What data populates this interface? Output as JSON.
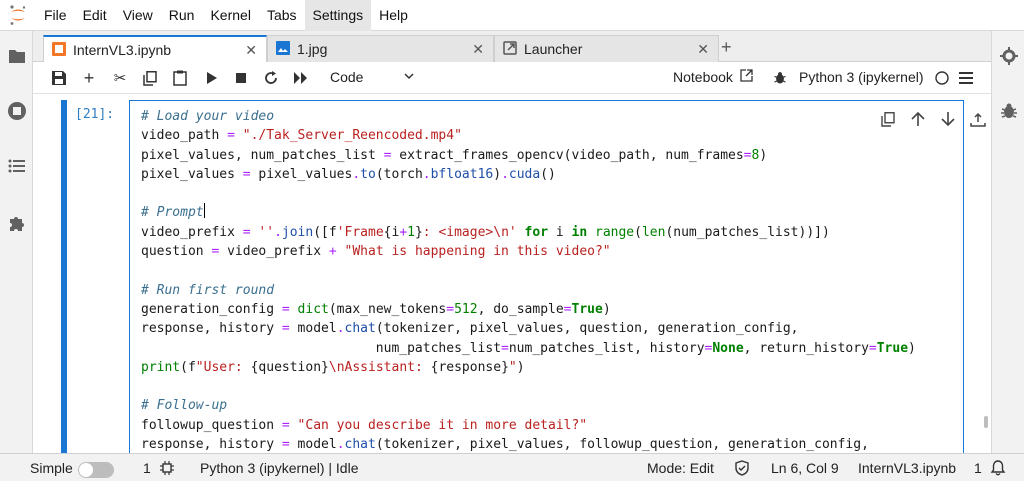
{
  "menu": {
    "items": [
      "File",
      "Edit",
      "View",
      "Run",
      "Kernel",
      "Tabs",
      "Settings",
      "Help"
    ],
    "active": "Settings"
  },
  "tabs": [
    {
      "label": "InternVL3.ipynb",
      "icon": "notebook-icon",
      "active": true
    },
    {
      "label": "1.jpg",
      "icon": "image-icon",
      "active": false
    },
    {
      "label": "Launcher",
      "icon": "launcher-icon",
      "active": false
    }
  ],
  "toolbar": {
    "cell_type": "Code",
    "notebook_label": "Notebook",
    "kernel_label": "Python 3 (ipykernel)"
  },
  "cell": {
    "prompt": "[21]:",
    "lines": [
      [
        [
          "c",
          "# Load your video"
        ]
      ],
      [
        [
          "",
          "video_path "
        ],
        [
          "o",
          "="
        ],
        [
          "",
          " "
        ],
        [
          "s",
          "\"./Tak_Server_Reencoded.mp4\""
        ]
      ],
      [
        [
          "",
          "pixel_values, num_patches_list "
        ],
        [
          "o",
          "="
        ],
        [
          "",
          " extract_frames_opencv(video_path, num_frames"
        ],
        [
          "o",
          "="
        ],
        [
          "n",
          "8"
        ],
        [
          "",
          ")"
        ]
      ],
      [
        [
          "",
          "pixel_values "
        ],
        [
          "o",
          "="
        ],
        [
          "",
          " pixel_values"
        ],
        [
          "o",
          "."
        ],
        [
          "f",
          "to"
        ],
        [
          "",
          "(torch"
        ],
        [
          "o",
          "."
        ],
        [
          "f",
          "bfloat16"
        ],
        [
          "",
          ")"
        ],
        [
          "o",
          "."
        ],
        [
          "f",
          "cuda"
        ],
        [
          "",
          "()"
        ]
      ],
      [],
      [
        [
          "c",
          "# Prompt"
        ],
        [
          "cursor",
          ""
        ]
      ],
      [
        [
          "",
          "video_prefix "
        ],
        [
          "o",
          "="
        ],
        [
          "",
          " "
        ],
        [
          "s",
          "''"
        ],
        [
          "o",
          "."
        ],
        [
          "f",
          "join"
        ],
        [
          "",
          "([f"
        ],
        [
          "s",
          "'Frame"
        ],
        [
          "",
          "{i"
        ],
        [
          "o",
          "+"
        ],
        [
          "n",
          "1"
        ],
        [
          "",
          "}"
        ],
        [
          "s",
          ": <image>\\n'"
        ],
        [
          "",
          " "
        ],
        [
          "k",
          "for"
        ],
        [
          "",
          " i "
        ],
        [
          "k",
          "in"
        ],
        [
          "",
          " "
        ],
        [
          "b",
          "range"
        ],
        [
          "",
          "("
        ],
        [
          "b",
          "len"
        ],
        [
          "",
          "(num_patches_list))])"
        ]
      ],
      [
        [
          "",
          "question "
        ],
        [
          "o",
          "="
        ],
        [
          "",
          " video_prefix "
        ],
        [
          "o",
          "+"
        ],
        [
          "",
          " "
        ],
        [
          "s",
          "\"What is happening in this video?\""
        ]
      ],
      [],
      [
        [
          "c",
          "# Run first round"
        ]
      ],
      [
        [
          "",
          "generation_config "
        ],
        [
          "o",
          "="
        ],
        [
          "",
          " "
        ],
        [
          "b",
          "dict"
        ],
        [
          "",
          "(max_new_tokens"
        ],
        [
          "o",
          "="
        ],
        [
          "n",
          "512"
        ],
        [
          "",
          ", do_sample"
        ],
        [
          "o",
          "="
        ],
        [
          "k",
          "True"
        ],
        [
          "",
          ")"
        ]
      ],
      [
        [
          "",
          "response, history "
        ],
        [
          "o",
          "="
        ],
        [
          "",
          " model"
        ],
        [
          "o",
          "."
        ],
        [
          "f",
          "chat"
        ],
        [
          "",
          "(tokenizer, pixel_values, question, generation_config,"
        ]
      ],
      [
        [
          "",
          "                              num_patches_list"
        ],
        [
          "o",
          "="
        ],
        [
          "",
          "num_patches_list, history"
        ],
        [
          "o",
          "="
        ],
        [
          "k",
          "None"
        ],
        [
          "",
          ", return_history"
        ],
        [
          "o",
          "="
        ],
        [
          "k",
          "True"
        ],
        [
          "",
          ")"
        ]
      ],
      [
        [
          "b",
          "print"
        ],
        [
          "",
          "(f"
        ],
        [
          "s",
          "\"User: "
        ],
        [
          "",
          "{question}"
        ],
        [
          "s",
          "\\nAssistant: "
        ],
        [
          "",
          "{response}"
        ],
        [
          "s",
          "\""
        ],
        [
          "",
          ")"
        ]
      ],
      [],
      [
        [
          "c",
          "# Follow-up"
        ]
      ],
      [
        [
          "",
          "followup_question "
        ],
        [
          "o",
          "="
        ],
        [
          "",
          " "
        ],
        [
          "s",
          "\"Can you describe it in more detail?\""
        ]
      ],
      [
        [
          "",
          "response, history "
        ],
        [
          "o",
          "="
        ],
        [
          "",
          " model"
        ],
        [
          "o",
          "."
        ],
        [
          "f",
          "chat"
        ],
        [
          "",
          "(tokenizer, pixel_values, followup_question, generation_config,"
        ]
      ]
    ]
  },
  "status": {
    "mode_toggle_label": "Simple",
    "terminals_count": "1",
    "kernel_status": "Python 3 (ipykernel) | Idle",
    "mode": "Mode: Edit",
    "position": "Ln 6, Col 9",
    "filename": "InternVL3.ipynb",
    "notifications_count": "1"
  },
  "colors": {
    "accent": "#1976d2",
    "comment": "#3a6f8f",
    "string": "#ba2121",
    "operator": "#aa22ff",
    "builtin": "#008000",
    "logo": "#f37726"
  }
}
